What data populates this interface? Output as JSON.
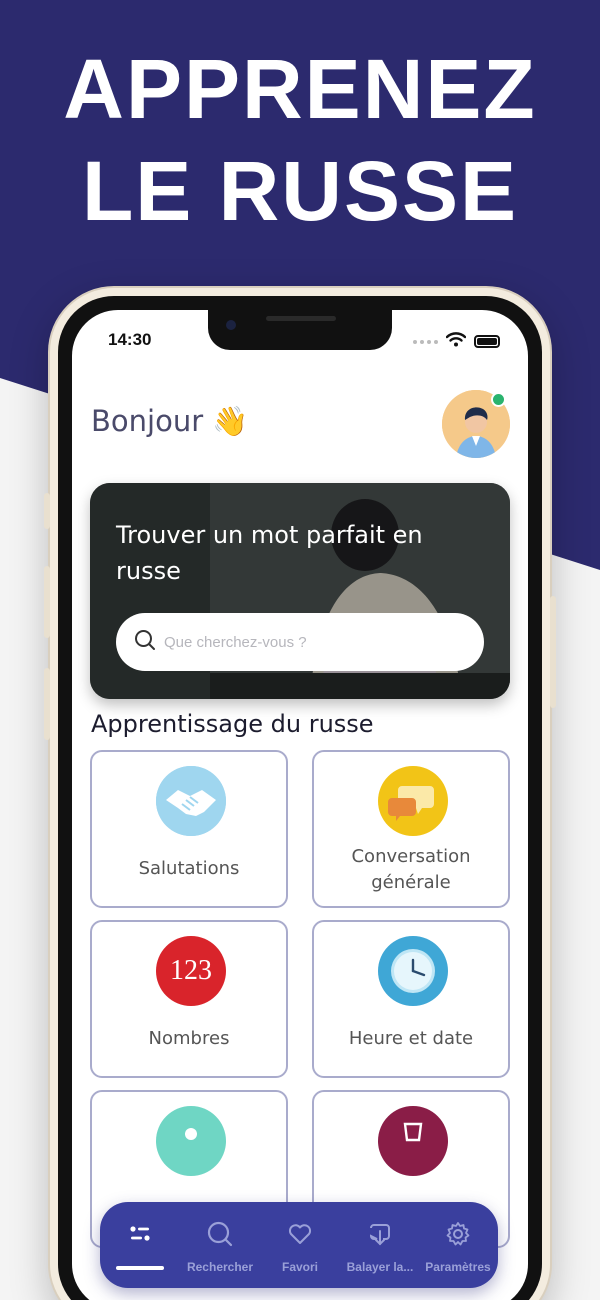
{
  "headline": {
    "line1": "APPRENEZ",
    "line2": "LE RUSSE"
  },
  "status_bar": {
    "time": "14:30"
  },
  "header": {
    "greeting": "Bonjour",
    "greeting_emoji": "👋"
  },
  "hero": {
    "title": "Trouver un mot parfait en russe",
    "search_placeholder": "Que cherchez-vous ?"
  },
  "learning": {
    "section_title": "Apprentissage du russe",
    "categories": [
      {
        "label": "Salutations",
        "icon": "handshake-icon"
      },
      {
        "label": "Conversation générale",
        "icon": "chat-bubbles-icon"
      },
      {
        "label": "Nombres",
        "icon": "numbers-123-icon",
        "icon_text": "123"
      },
      {
        "label": "Heure et date",
        "icon": "clock-icon"
      },
      {
        "label": "",
        "icon": "location-pin-icon"
      },
      {
        "label": "",
        "icon": "glass-icon"
      }
    ]
  },
  "tabbar": {
    "tabs": [
      {
        "label": "",
        "icon": "list-icon",
        "active": true
      },
      {
        "label": "Rechercher",
        "icon": "search-icon"
      },
      {
        "label": "Favori",
        "icon": "heart-icon"
      },
      {
        "label": "Balayer la...",
        "icon": "download-tray-icon"
      },
      {
        "label": "Paramètres",
        "icon": "gear-icon"
      }
    ]
  },
  "colors": {
    "brand_navy": "#2c2a6e",
    "tabbar": "#3a3f9e",
    "card_border": "#a9abcc",
    "online": "#2ab36e"
  }
}
